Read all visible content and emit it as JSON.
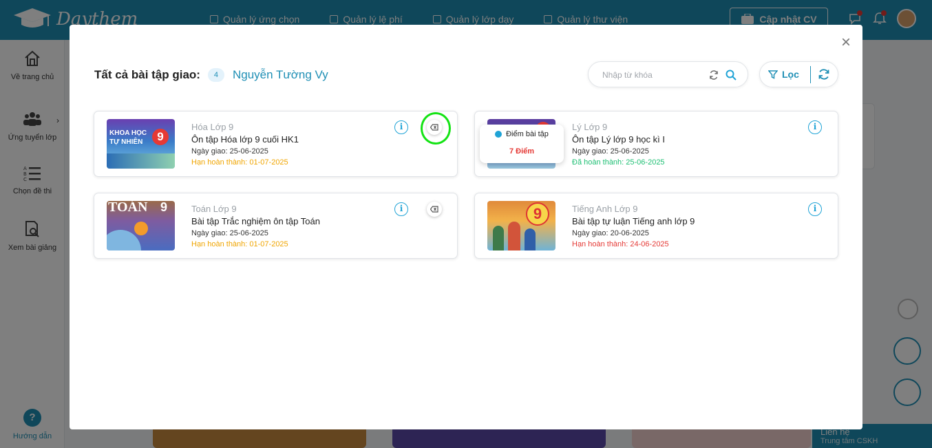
{
  "app": {
    "logo_text": "Daythem",
    "nav": [
      {
        "label": "Quản lý ứng chọn"
      },
      {
        "label": "Quản lý lệ phí"
      },
      {
        "label": "Quản lý lớp dạy"
      },
      {
        "label": "Quản lý thư viện"
      }
    ],
    "cv_button": "Cập nhật CV"
  },
  "sidebar": {
    "items": [
      {
        "label": "Về trang chủ",
        "icon": "home-icon"
      },
      {
        "label": "Ứng tuyển lớp",
        "icon": "group-icon"
      },
      {
        "label": "Chọn đề thi",
        "icon": "list-icon"
      },
      {
        "label": "Xem bài giảng",
        "icon": "document-search-icon"
      }
    ],
    "help_label": "Hướng dẫn"
  },
  "contact": {
    "line1": "Liên hệ",
    "line2": "Trung tâm CSKH"
  },
  "modal": {
    "title": "Tất cả bài tập giao:",
    "count": "4",
    "student": "Nguyễn Tường Vy",
    "search_placeholder": "Nhập từ khóa",
    "filter_label": "Lọc",
    "close_symbol": "×",
    "score_popup": {
      "label": "Điểm bài tập",
      "value": "7 Điểm"
    },
    "cards": [
      {
        "subject": "Hóa Lớp 9",
        "name": "Ôn tập Hóa lớp 9 cuối HK1",
        "date": "Ngày giao: 25-06-2025",
        "deadline": "Hạn hoàn thành: 01-07-2025",
        "deadline_color": "#f0a500",
        "thumb_text": "KHOA HỌC TỰ NHIÊN",
        "thumb_num": "9"
      },
      {
        "subject": "Lý Lớp 9",
        "name": "Ôn tập Lý lớp 9 học kì I",
        "date": "Ngày giao: 25-06-2025",
        "deadline": "Đã hoàn thành: 25-06-2025",
        "deadline_color": "#1dbf73",
        "thumb_text": "",
        "thumb_num": "9"
      },
      {
        "subject": "Toán Lớp 9",
        "name": "Bài tập Trắc nghiệm ôn tập Toán",
        "date": "Ngày giao: 25-06-2025",
        "deadline": "Hạn hoàn thành: 01-07-2025",
        "deadline_color": "#f0a500",
        "thumb_text": "TOÁN",
        "thumb_num": "9"
      },
      {
        "subject": "Tiếng Anh Lớp 9",
        "name": "Bài tập tự luận Tiếng anh lớp 9",
        "date": "Ngày giao: 20-06-2025",
        "deadline": "Hạn hoàn thành: 24-06-2025",
        "deadline_color": "#e53935",
        "thumb_text": "",
        "thumb_num": "9"
      }
    ]
  },
  "colors": {
    "brand": "#1f8fb5",
    "accent": "#1fa3d6",
    "highlight": "#14e314"
  }
}
